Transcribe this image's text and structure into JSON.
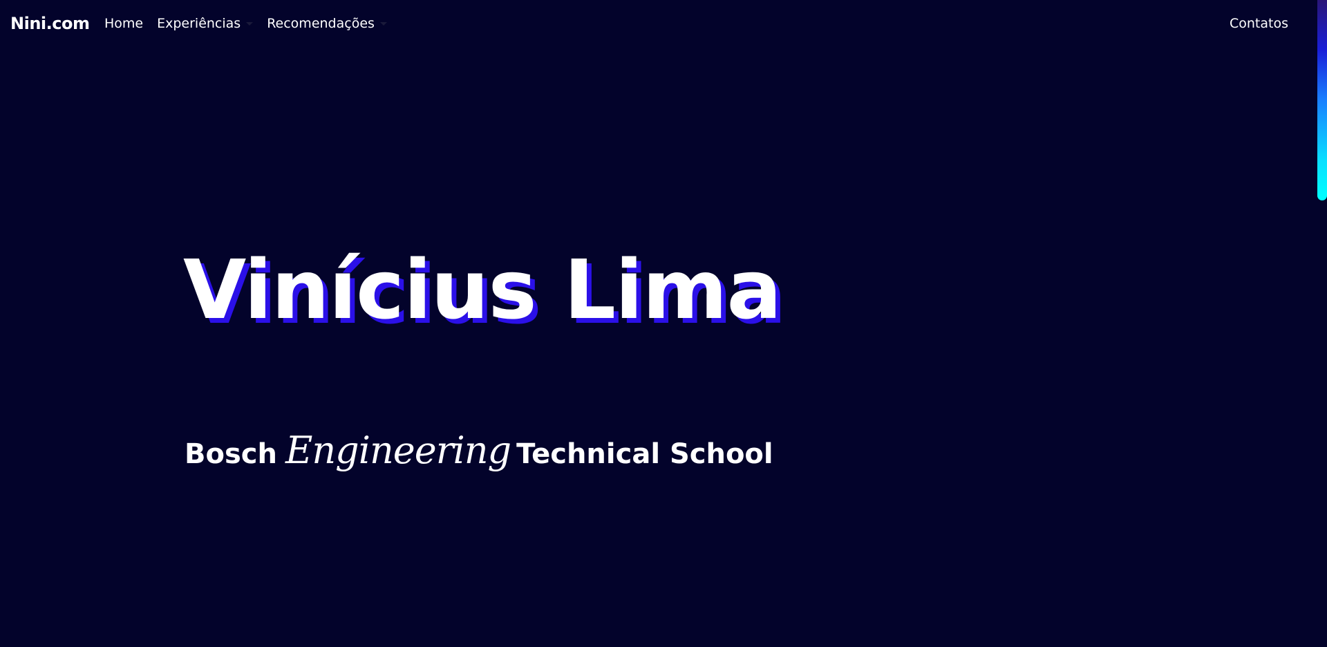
{
  "navbar": {
    "brand": "Nini.com",
    "links": [
      {
        "label": "Home"
      },
      {
        "label": "Experiências",
        "dropdown": true
      },
      {
        "label": "Recomendações",
        "dropdown": true
      }
    ],
    "contact": "Contatos"
  },
  "hero": {
    "name": "Vinícius Lima",
    "subtitle": {
      "part1": "Bosch",
      "script": "Engineering",
      "part2": "Technical School"
    }
  },
  "colors": {
    "background": "#03032b",
    "text": "#ffffff",
    "shadow_accent": "#2b10e8",
    "scroll_thumb_top": "#2a1677",
    "scroll_thumb_bottom": "#00ffff"
  }
}
